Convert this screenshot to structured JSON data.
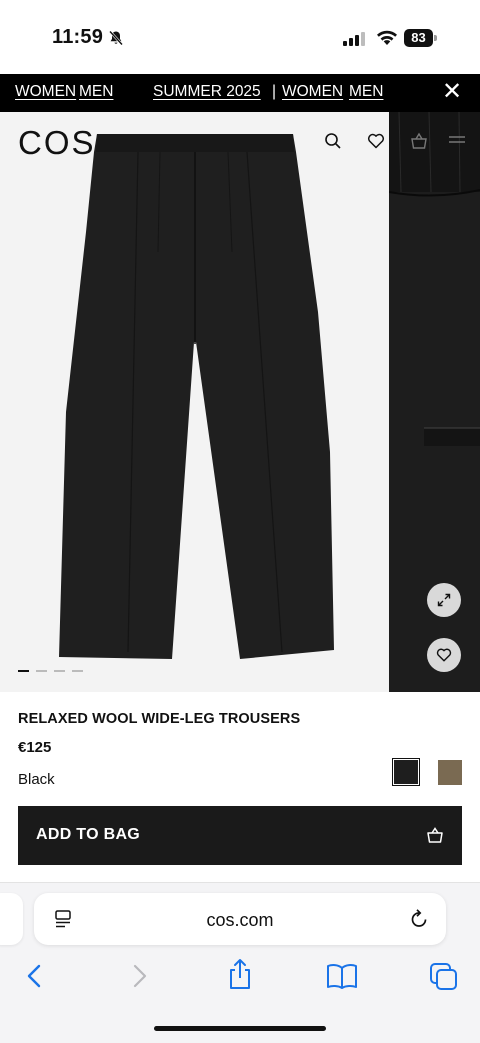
{
  "status_bar": {
    "time": "11:59",
    "battery": "83"
  },
  "banner": {
    "links": [
      "WOMEN",
      "MEN",
      "SUMMER 2025",
      "WOMEN",
      "MEN"
    ],
    "separator": "|",
    "close_symbol": "✕"
  },
  "header": {
    "logo": "COS"
  },
  "gallery": {
    "slide_count": 4,
    "active_slide": 1
  },
  "product": {
    "name": "RELAXED WOOL WIDE-LEG TROUSERS",
    "price": "€125",
    "color_name": "Black",
    "swatches": [
      {
        "name": "Black",
        "color": "#1e1e1e",
        "selected": true
      },
      {
        "name": "Brown",
        "color": "#7a6a52",
        "selected": false
      }
    ]
  },
  "actions": {
    "add_to_bag": "ADD TO BAG"
  },
  "browser": {
    "url": "cos.com"
  }
}
